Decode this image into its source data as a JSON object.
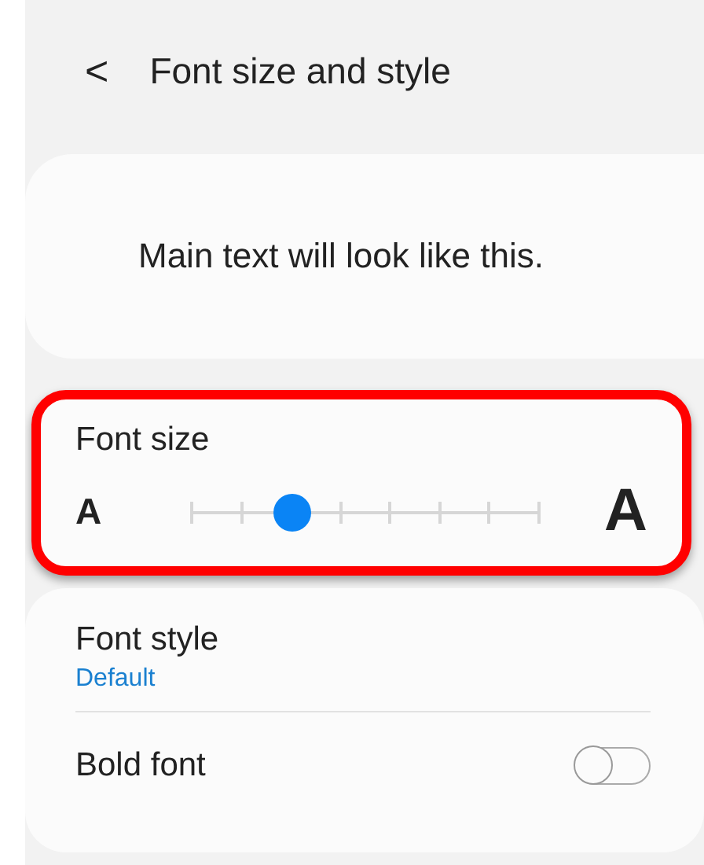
{
  "header": {
    "back_icon": "<",
    "title": "Font size and style"
  },
  "preview": {
    "text": "Main text will look like this."
  },
  "font_size": {
    "label": "Font size",
    "small_glyph": "A",
    "large_glyph": "A",
    "level": 0.2857,
    "highlighted": true
  },
  "settings": [
    {
      "kind": "value",
      "label": "Font style",
      "value": "Default"
    },
    {
      "kind": "toggle",
      "label": "Bold font",
      "on": false
    }
  ]
}
